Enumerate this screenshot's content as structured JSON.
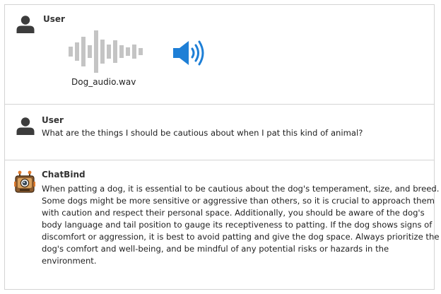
{
  "messages": [
    {
      "sender": "User",
      "icon": "user-icon",
      "attachment": {
        "filename": "Dog_audio.wav",
        "waveform_icon": "audio-waveform-icon",
        "play_icon": "speaker-icon"
      }
    },
    {
      "sender": "User",
      "icon": "user-icon",
      "text": "What are the things I should be cautious about when I pat this kind of animal?"
    },
    {
      "sender": "ChatBind",
      "icon": "robot-icon",
      "lines": [
        "When patting a dog, it is essential to be cautious about the dog's temperament, size, and breed.",
        "Some dogs might be more sensitive or aggressive than others, so it is crucial to approach them",
        "with caution and respect their personal space. Additionally, you should be aware of the dog's",
        "body language and tail position to gauge its receptiveness to patting. If the dog shows signs of",
        "discomfort or aggression, it is best to avoid patting and give the dog space. Always prioritize the",
        "dog's comfort and well-being, and be mindful of any potential risks or hazards in the",
        "environment."
      ]
    }
  ],
  "colors": {
    "speaker_blue": "#1e7fd6",
    "waveform_gray": "#c4c4c4",
    "avatar_dark": "#3c3c3c",
    "border": "#d4d4d4"
  }
}
